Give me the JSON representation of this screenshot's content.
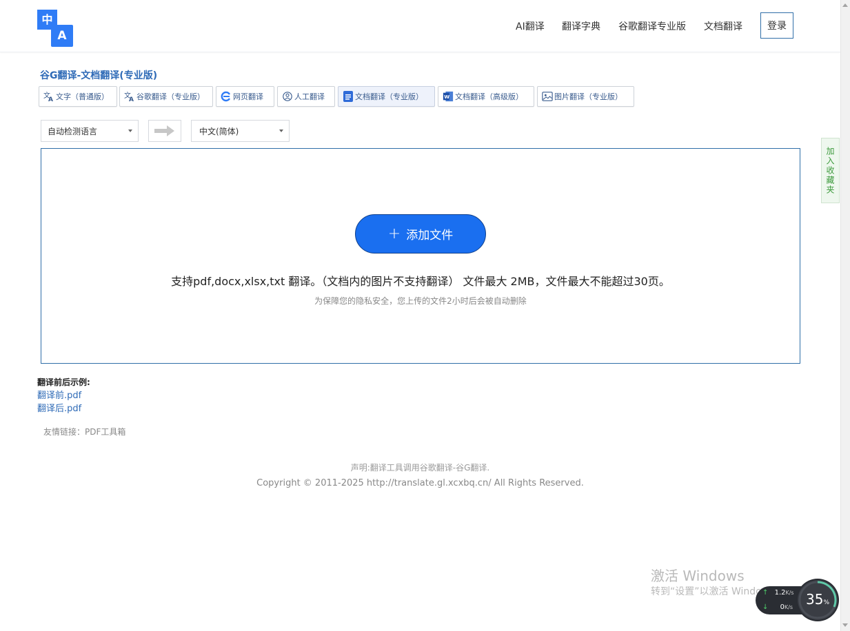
{
  "header": {
    "logo_top": "中",
    "logo_bottom": "A",
    "nav": [
      "AI翻译",
      "翻译字典",
      "谷歌翻译专业版",
      "文档翻译"
    ],
    "login": "登录"
  },
  "page_title": "谷G翻译-文档翻译(专业版)",
  "tabs": [
    {
      "label": "文字（普通版）",
      "icon": "translate-icon"
    },
    {
      "label": "谷歌翻译（专业版）",
      "icon": "translate-icon"
    },
    {
      "label": "网页翻译",
      "icon": "browser-icon"
    },
    {
      "label": "人工翻译",
      "icon": "human-icon"
    },
    {
      "label": "文档翻译（专业版）",
      "icon": "document-icon",
      "active": true
    },
    {
      "label": "文档翻译（高级版）",
      "icon": "word-icon"
    },
    {
      "label": "图片翻译（专业版）",
      "icon": "image-icon"
    }
  ],
  "languages": {
    "source": "自动检测语言",
    "target": "中文(简体)"
  },
  "upload": {
    "button": "添加文件",
    "support_text": "支持pdf,docx,xlsx,txt 翻译。（文档内的图片不支持翻译） 文件最大 2MB，文件最大不能超过30页。",
    "privacy_text": "为保障您的隐私安全，您上传的文件2小时后会被自动删除"
  },
  "examples": {
    "title": "翻译前后示例:",
    "links": [
      "翻译前.pdf",
      "翻译后.pdf"
    ]
  },
  "friend_links": "友情链接：PDF工具箱",
  "footer": {
    "statement": "声明:翻译工具调用谷歌翻译-谷G翻译.",
    "copyright": "Copyright © 2011-2025 http://translate.gl.xcxbq.cn/ All Rights Reserved."
  },
  "side_favorite": "加入收藏夹",
  "watermark": {
    "line1": "激活 Windows",
    "line2": "转到“设置”以激活 Windows。"
  },
  "network": {
    "up": "1.2",
    "down": "0",
    "unit": "K/s",
    "cpu_percent": "35",
    "percent_sign": "%"
  }
}
